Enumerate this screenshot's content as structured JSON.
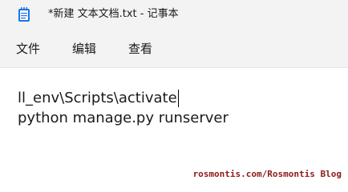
{
  "window": {
    "title": "*新建 文本文档.txt - 记事本",
    "icon": "notepad-icon"
  },
  "menu": {
    "file_label": "文件",
    "edit_label": "编辑",
    "view_label": "查看"
  },
  "editor": {
    "lines": [
      "ll_env\\Scripts\\activate",
      "python manage.py runserver"
    ]
  },
  "watermark": {
    "text": "rosmontis.com/Rosmontis  Blog"
  },
  "colors": {
    "chrome_background": "#f3f3f3",
    "editor_background": "#ffffff",
    "text": "#1a1a1a",
    "icon_accent": "#1a73e8",
    "watermark": "#8b1a1a"
  }
}
